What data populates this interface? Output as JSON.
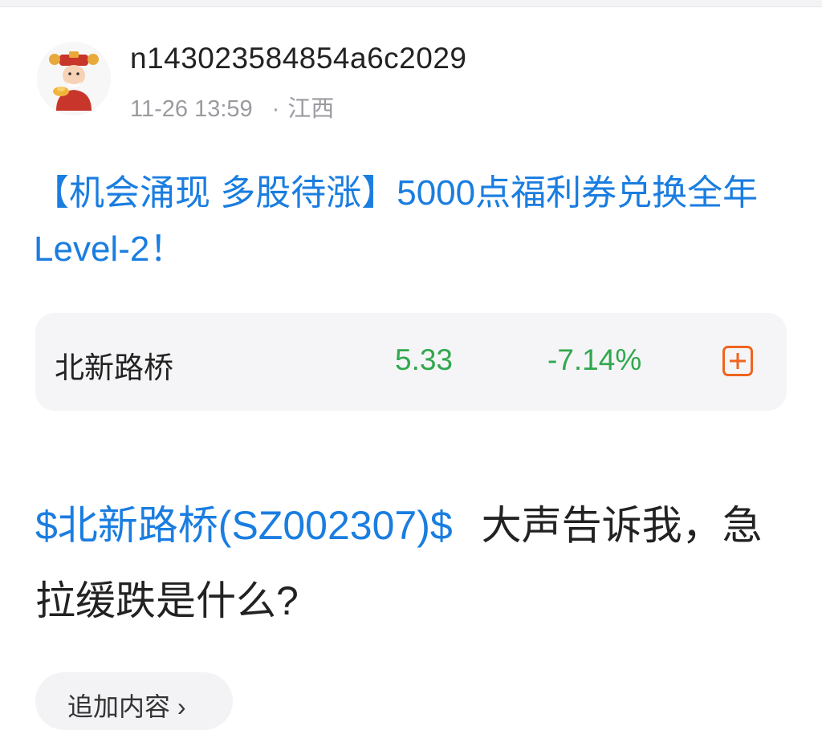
{
  "post": {
    "username": "n143023584854a6c2029",
    "date": "11-26 13:59",
    "location": "江西",
    "separator": "·",
    "promo_text": "【机会涌现 多股待涨】5000点福利券兑换全年Level-2！",
    "body_tag": "$北新路桥(SZ002307)$",
    "body_text": "大声告诉我，急拉缓跌是什么?"
  },
  "stock": {
    "name": "北新路桥",
    "price": "5.33",
    "change": "-7.14%",
    "add_icon": "plus-square-icon"
  },
  "follow": {
    "label": "追加内容 ›"
  },
  "colors": {
    "link_blue": "#1a7de0",
    "down_green": "#31a84e",
    "accent_orange": "#f0641e"
  }
}
